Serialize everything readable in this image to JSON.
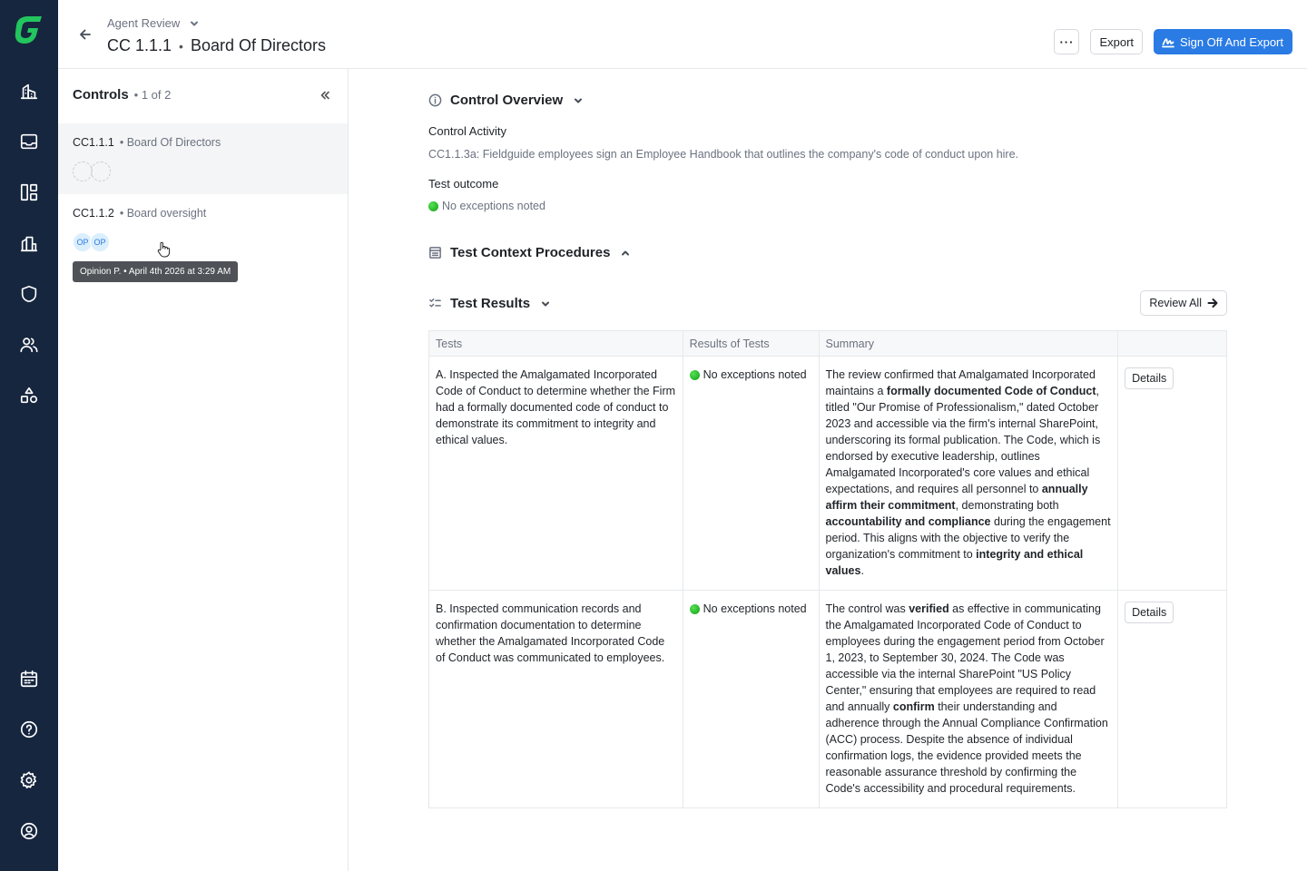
{
  "header": {
    "breadcrumb": "Agent Review",
    "control_id": "CC 1.1.1",
    "title_separator": "•",
    "control_name": "Board Of Directors",
    "more_label": "···",
    "export_label": "Export",
    "sign_off_label": "Sign Off And Export"
  },
  "panel": {
    "title": "Controls",
    "count": "• 1 of 2",
    "controls": [
      {
        "id": "CC1.1.1",
        "name": "• Board Of Directors",
        "avatars": []
      },
      {
        "id": "CC1.1.2",
        "name": "• Board oversight",
        "avatars": [
          "OP",
          "OP"
        ]
      }
    ],
    "tooltip": "Opinion P. • April 4th 2026 at 3:29 AM"
  },
  "overview": {
    "title": "Control Overview",
    "activity_label": "Control Activity",
    "activity_text": "CC1.1.3a: Fieldguide employees sign an Employee Handbook that outlines the company's code of conduct upon hire.",
    "outcome_label": "Test outcome",
    "outcome_text": "No exceptions noted"
  },
  "procedures": {
    "title": "Test Context Procedures"
  },
  "results": {
    "title": "Test Results",
    "review_all_label": "Review All",
    "columns": [
      "Tests",
      "Results of Tests",
      "Summary",
      ""
    ],
    "rows": [
      {
        "test": "A. Inspected the Amalgamated Incorporated Code of Conduct to determine whether the Firm had a formally documented code of conduct to demonstrate its commitment to integrity and ethical values.",
        "result": "No exceptions noted",
        "summary": [
          {
            "t": "The review confirmed that Amalgamated Incorporated maintains a ",
            "b": false
          },
          {
            "t": "formally documented Code of Conduct",
            "b": true
          },
          {
            "t": ", titled \"Our Promise of Professionalism,\" dated October 2023 and accessible via the firm's internal SharePoint, underscoring its formal publication. The Code, which is endorsed by executive leadership, outlines Amalgamated Incorporated's core values and ethical expectations, and requires all personnel to ",
            "b": false
          },
          {
            "t": "annually affirm their commitment",
            "b": true
          },
          {
            "t": ", demonstrating both ",
            "b": false
          },
          {
            "t": "accountability and compliance",
            "b": true
          },
          {
            "t": " during the engagement period. This aligns with the objective to verify the organization's commitment to ",
            "b": false
          },
          {
            "t": "integrity and ethical values",
            "b": true
          },
          {
            "t": ".",
            "b": false
          }
        ],
        "details_label": "Details"
      },
      {
        "test": "B. Inspected communication records and confirmation documentation to determine whether the Amalgamated Incorporated Code of Conduct was communicated to employees.",
        "result": "No exceptions noted",
        "summary": [
          {
            "t": "The control was ",
            "b": false
          },
          {
            "t": "verified",
            "b": true
          },
          {
            "t": " as effective in communicating the Amalgamated Incorporated Code of Conduct to employees during the engagement period from October 1, 2023, to September 30, 2024. The Code was accessible via the internal SharePoint \"US Policy Center,\" ensuring that employees are required to read and annually ",
            "b": false
          },
          {
            "t": "confirm",
            "b": true
          },
          {
            "t": " their understanding and adherence through the Annual Compliance Confirmation (ACC) process. Despite the absence of individual confirmation logs, the evidence provided meets the reasonable assurance threshold by confirming the Code's accessibility and procedural requirements.",
            "b": false
          }
        ],
        "details_label": "Details"
      }
    ]
  },
  "colors": {
    "rail": "#17263f",
    "accent": "#2a7be4",
    "logo": "#22c55e",
    "success": "#13a013"
  }
}
